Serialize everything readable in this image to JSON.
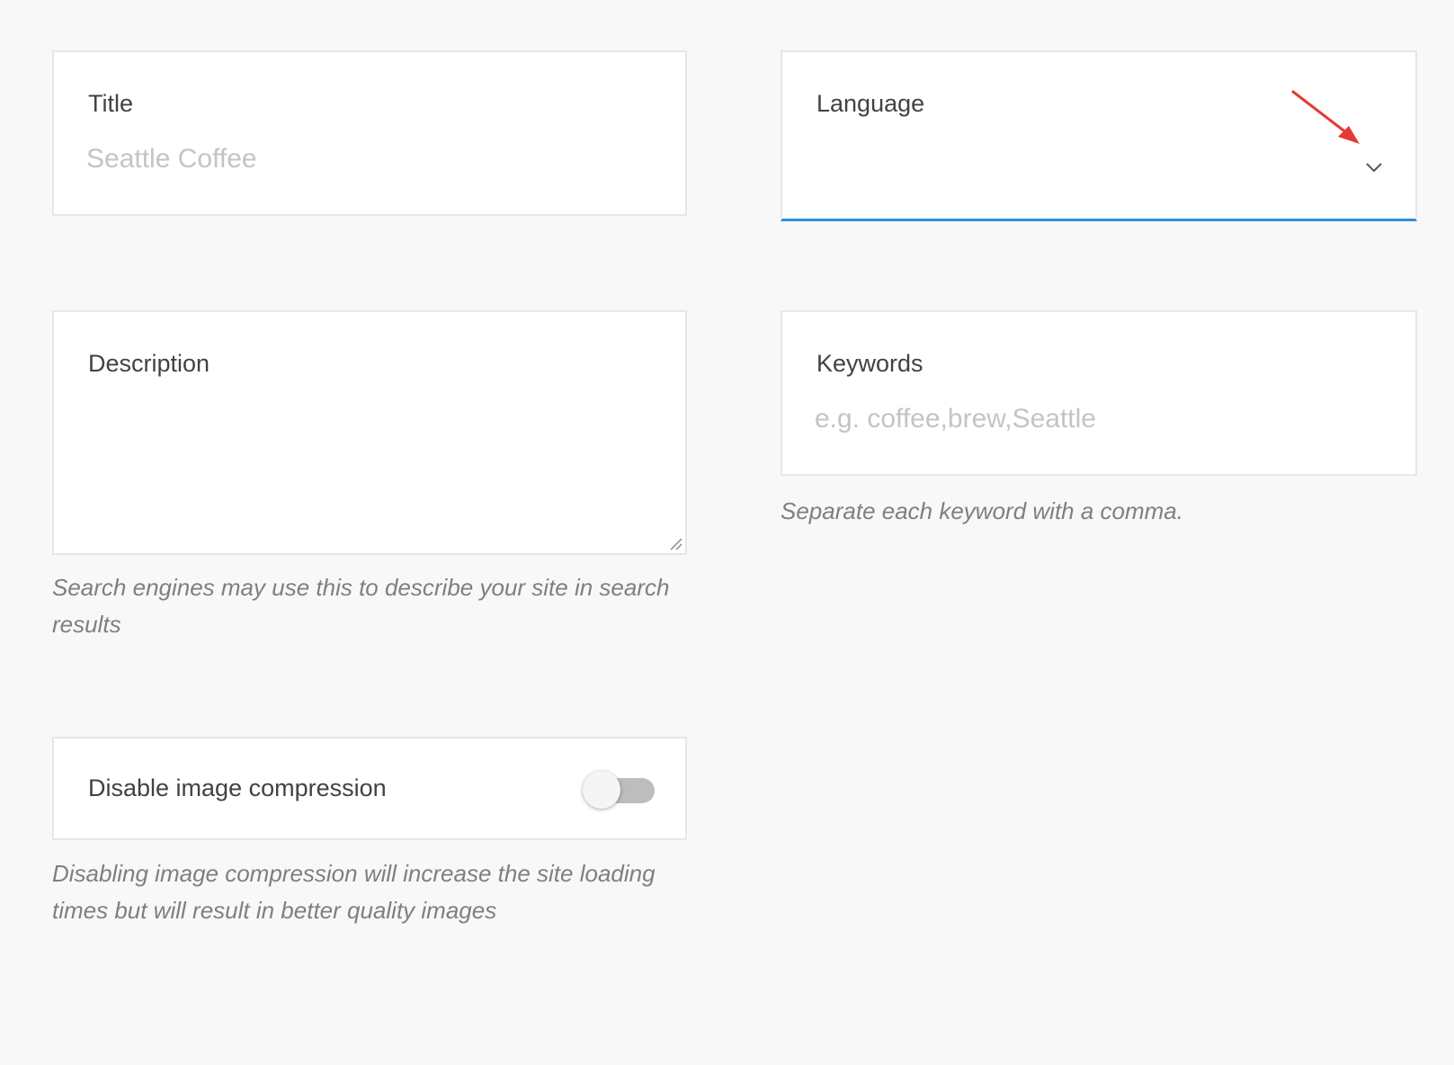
{
  "title_field": {
    "label": "Title",
    "placeholder": "Seattle Coffee",
    "value": ""
  },
  "language_field": {
    "label": "Language",
    "selected_value": "",
    "icon": "chevron-down-icon",
    "focus_color": "#2e8ee0"
  },
  "annotation": {
    "icon": "red-arrow-annotation",
    "color": "#e53935"
  },
  "description_field": {
    "label": "Description",
    "value": "",
    "help_text": "Search engines may use this to describe your site in search results"
  },
  "keywords_field": {
    "label": "Keywords",
    "placeholder": "e.g. coffee,brew,Seattle",
    "value": "",
    "help_text": "Separate each keyword with a comma."
  },
  "image_compression": {
    "label": "Disable image compression",
    "enabled": false,
    "help_text": "Disabling image compression will increase the site loading times but will result in better quality images"
  }
}
